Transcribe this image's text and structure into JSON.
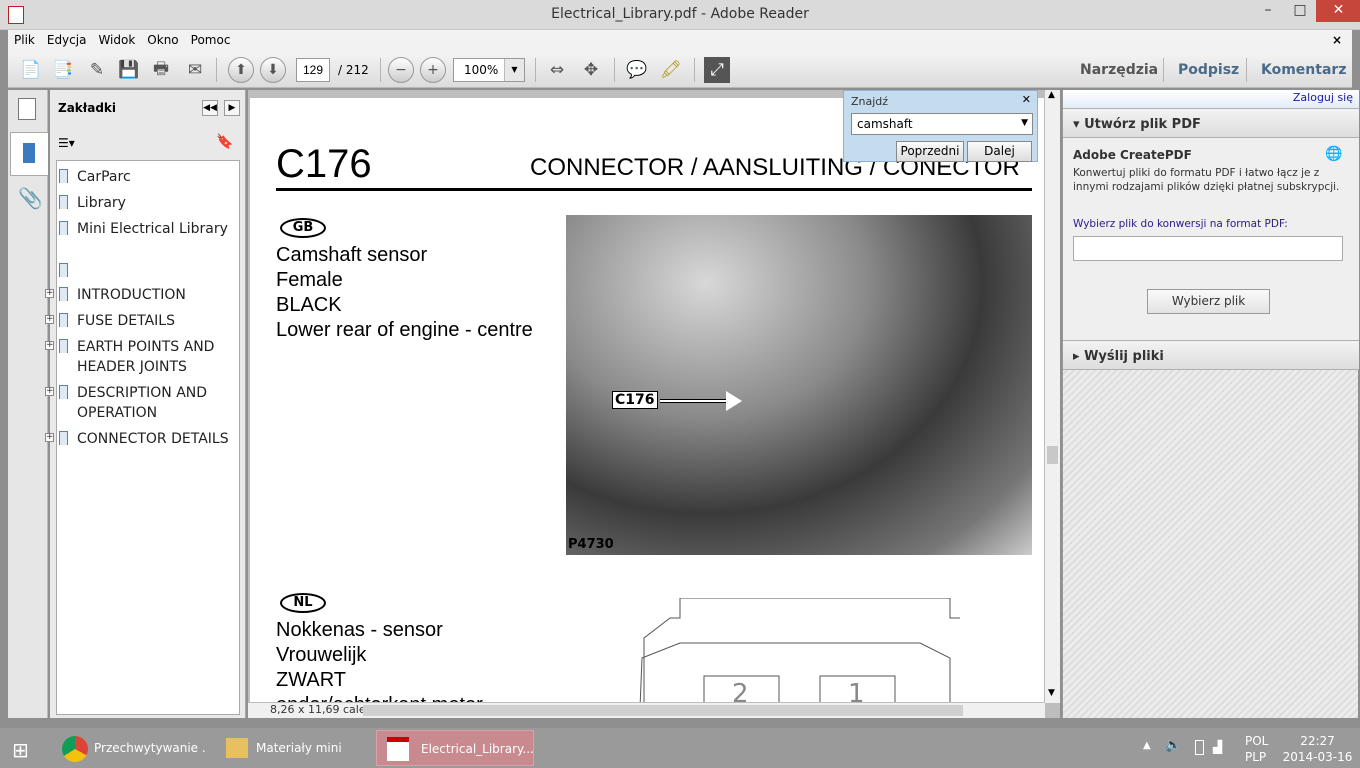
{
  "window": {
    "title": "Electrical_Library.pdf - Adobe Reader",
    "minimize": "–",
    "maximize": "□",
    "close": "✕"
  },
  "menu": {
    "items": [
      "Plik",
      "Edycja",
      "Widok",
      "Okno",
      "Pomoc"
    ],
    "close": "×"
  },
  "toolbar": {
    "page_current": "129",
    "page_total": "/ 212",
    "zoom": "100%",
    "right_links": [
      "Narzędzia",
      "Podpisz",
      "Komentarz"
    ]
  },
  "bookmarks": {
    "title": "Zakładki",
    "items": [
      {
        "label": "CarParc",
        "expandable": false
      },
      {
        "label": "Library",
        "expandable": false
      },
      {
        "label": "Mini Electrical Library",
        "expandable": false
      },
      {
        "label": "",
        "expandable": false
      },
      {
        "label": "INTRODUCTION",
        "expandable": true
      },
      {
        "label": "FUSE DETAILS",
        "expandable": true
      },
      {
        "label": "EARTH POINTS AND HEADER JOINTS",
        "expandable": true
      },
      {
        "label": "DESCRIPTION AND OPERATION",
        "expandable": true
      },
      {
        "label": "CONNECTOR DETAILS",
        "expandable": true
      }
    ]
  },
  "find": {
    "title": "Znajdź",
    "query": "camshaft",
    "prev": "Poprzedni",
    "next": "Dalej"
  },
  "document": {
    "code": "C176",
    "heading": "CONNECTOR / AANSLUITING / CONECTOR",
    "gb": {
      "badge": "GB",
      "lines": [
        "Camshaft sensor",
        "Female",
        "BLACK",
        "Lower rear of engine - centre"
      ]
    },
    "photo": {
      "callout": "C176",
      "ref": "P4730"
    },
    "nl": {
      "badge": "NL",
      "lines": [
        "Nokkenas - sensor",
        "Vrouwelijk",
        "ZWART",
        "onder/achterkant motor"
      ]
    },
    "pins": [
      "2",
      "1"
    ],
    "page_size": "8,26 x 11,69 cale"
  },
  "right_panel": {
    "login": "Zaloguj się",
    "create_title": "Utwórz plik PDF",
    "service": "Adobe CreatePDF",
    "description": "Konwertuj pliki do formatu PDF i łatwo łącz je z innymi rodzajami plików dzięki płatnej subskrypcji.",
    "choose_label": "Wybierz plik do konwersji na format PDF:",
    "choose_button": "Wybierz plik",
    "send_title": "Wyślij pliki"
  },
  "taskbar": {
    "items": [
      "Przechwytywanie ...",
      "Materiały mini",
      "Electrical_Library...."
    ],
    "lang1": "POL",
    "lang2": "PLP",
    "time": "22:27",
    "date": "2014-03-16"
  }
}
